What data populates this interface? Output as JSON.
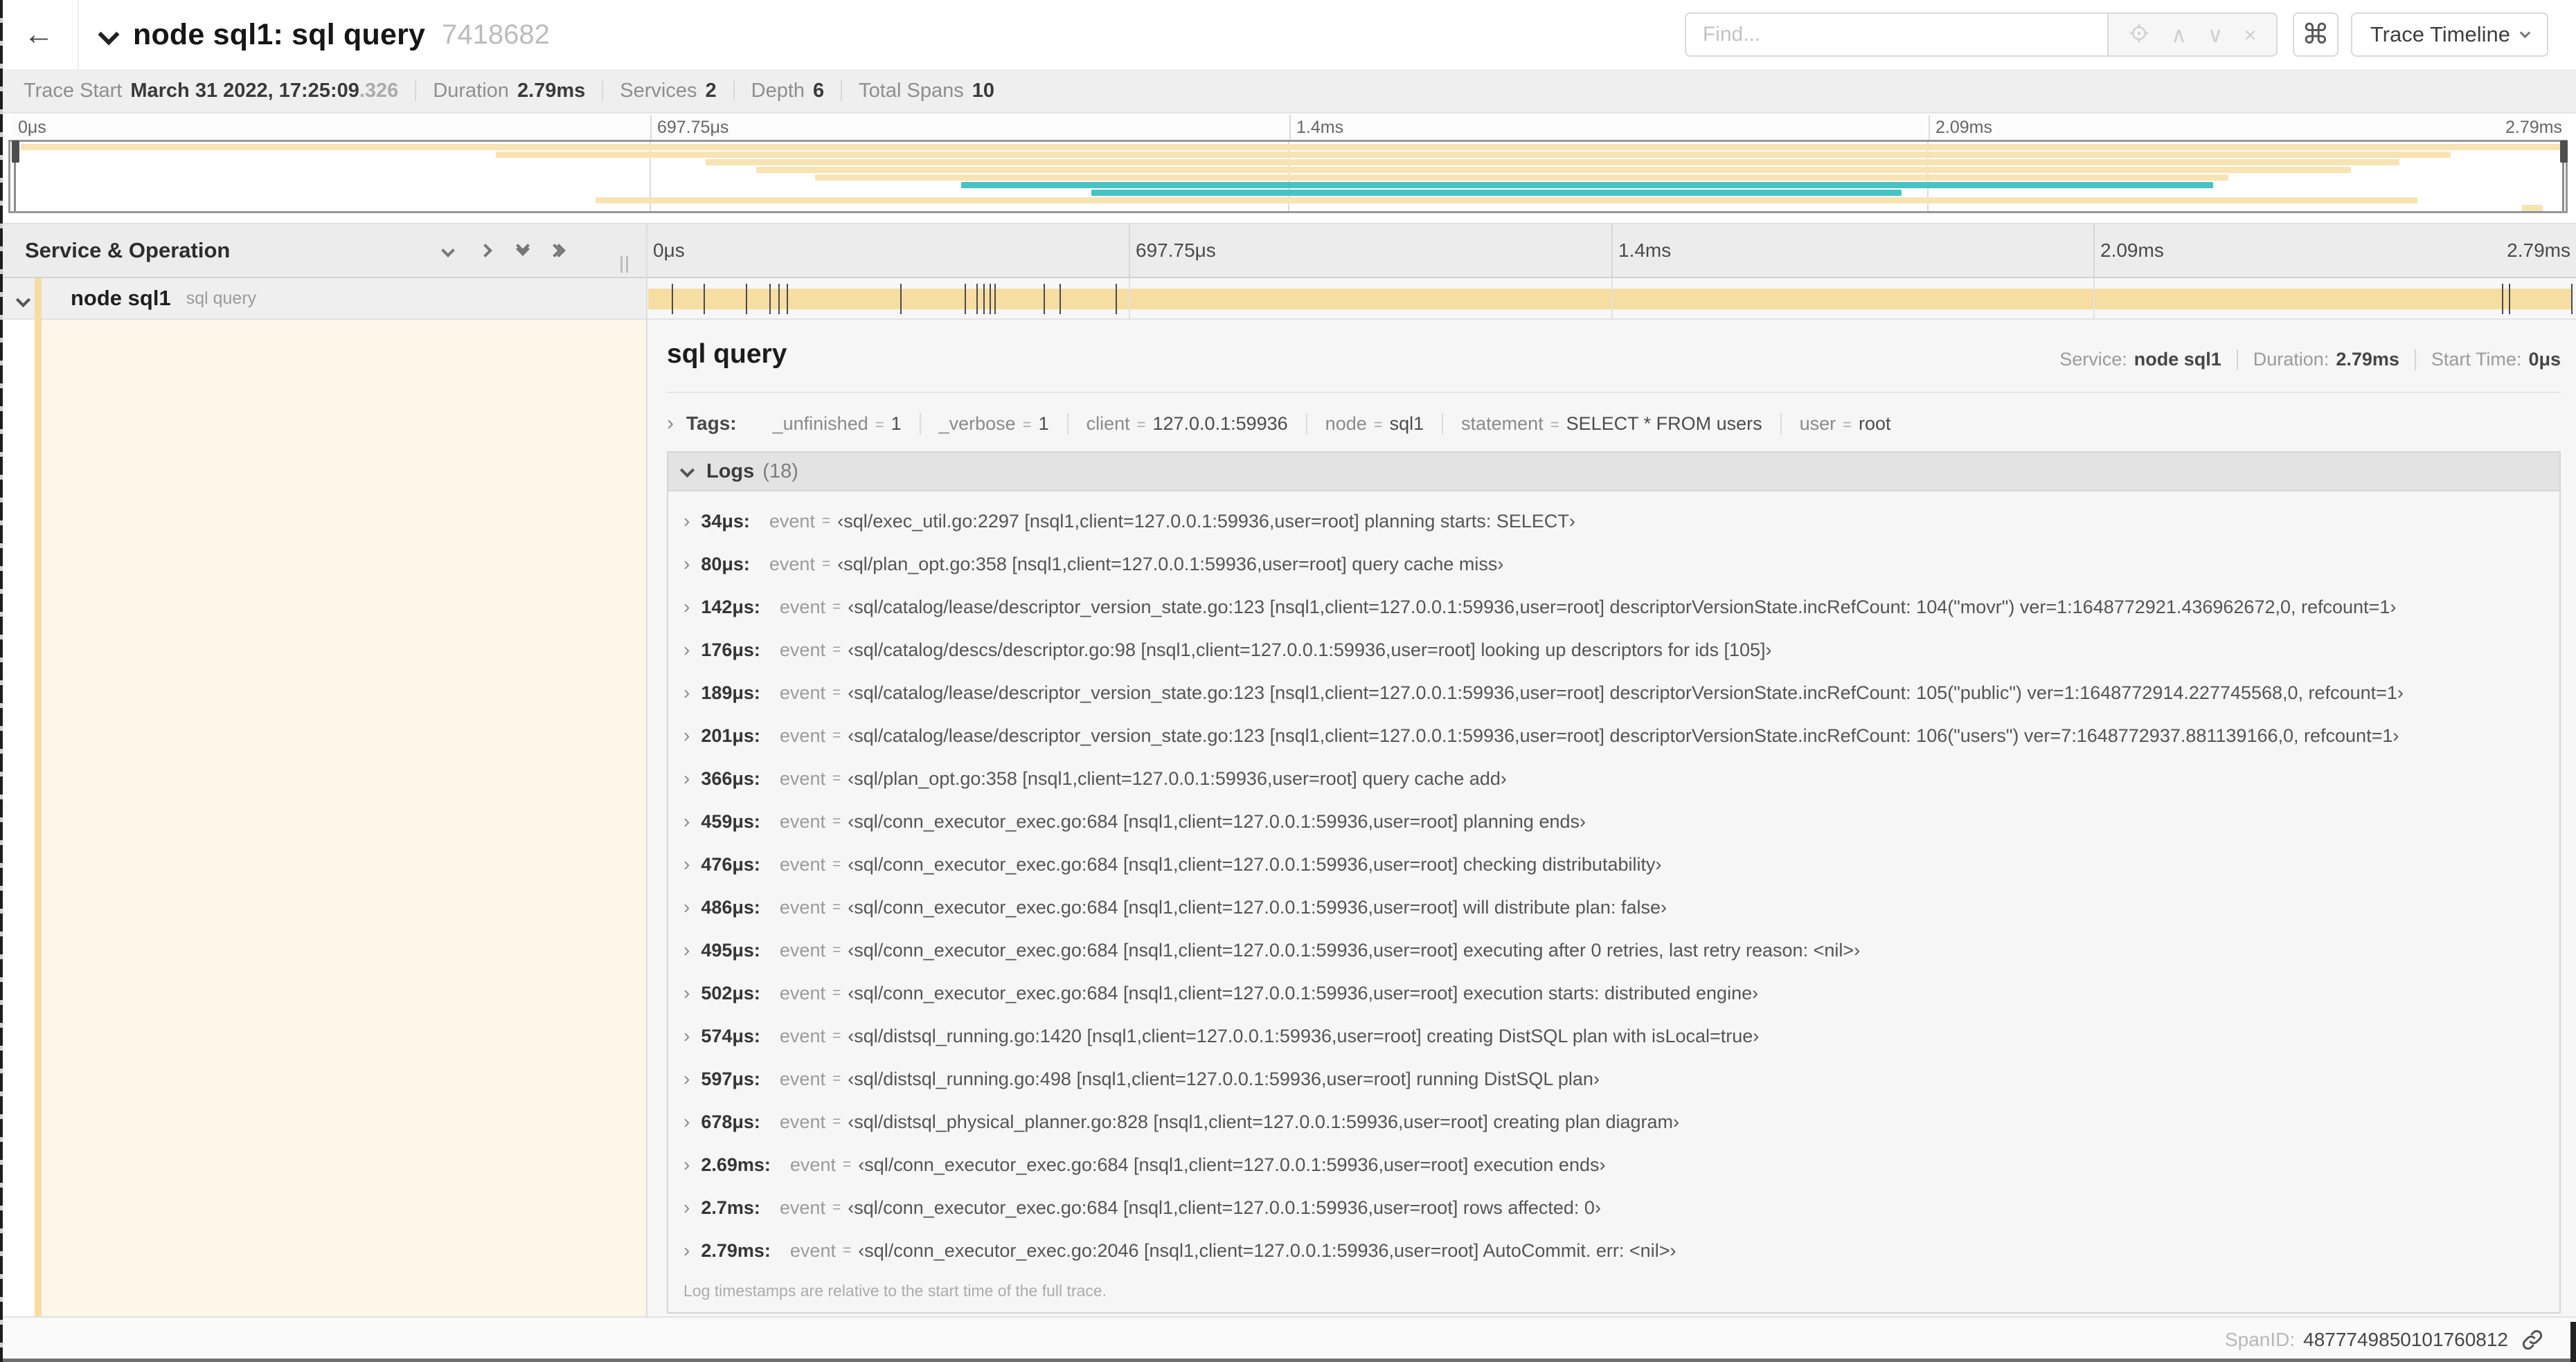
{
  "colors": {
    "tan": "#f8e3b3",
    "bar_tan": "#f6dda1",
    "teal": "#48c3c3",
    "cream": "#fdf6e9"
  },
  "header": {
    "back_icon": "←",
    "title": "node sql1: sql query",
    "trace_id": "7418682",
    "find_placeholder": "Find...",
    "icons": {
      "up": "∧",
      "down": "∨",
      "close": "×"
    },
    "shortcut_icon": "⌘",
    "view_selector": "Trace Timeline"
  },
  "summary": {
    "trace_start_label": "Trace Start",
    "trace_start_value": "March 31 2022, 17:25:09",
    "trace_start_ms": ".326",
    "duration_label": "Duration",
    "duration_value": "2.79ms",
    "services_label": "Services",
    "services_value": "2",
    "depth_label": "Depth",
    "depth_value": "6",
    "total_spans_label": "Total Spans",
    "total_spans_value": "10"
  },
  "ruler": {
    "ticks": [
      "0μs",
      "697.75μs",
      "1.4ms",
      "2.09ms",
      "2.79ms"
    ],
    "tick_positions": [
      0,
      0.25,
      0.5,
      0.75,
      1
    ]
  },
  "minimap": {
    "spans": [
      {
        "row": 0,
        "start": 0.004,
        "end": 1.0,
        "color": "tan"
      },
      {
        "row": 1,
        "start": 0.19,
        "end": 0.955,
        "color": "tan"
      },
      {
        "row": 2,
        "start": 0.272,
        "end": 0.935,
        "color": "tan"
      },
      {
        "row": 3,
        "start": 0.292,
        "end": 0.916,
        "color": "tan"
      },
      {
        "row": 4,
        "start": 0.315,
        "end": 0.868,
        "color": "tan"
      },
      {
        "row": 5,
        "start": 0.372,
        "end": 0.862,
        "color": "teal"
      },
      {
        "row": 6,
        "start": 0.423,
        "end": 0.74,
        "color": "teal"
      },
      {
        "row": 7,
        "start": 0.229,
        "end": 0.942,
        "color": "tan"
      },
      {
        "row": 8,
        "start": 0.983,
        "end": 0.991,
        "color": "tan"
      }
    ]
  },
  "timeline_header": {
    "label": "Service & Operation"
  },
  "span_row": {
    "service": "node sql1",
    "operation": "sql query",
    "trace_duration_us": 2790,
    "log_marker_times_us": [
      34,
      80,
      142,
      176,
      189,
      201,
      366,
      459,
      476,
      486,
      495,
      502,
      574,
      597,
      678,
      2690,
      2700,
      2790
    ]
  },
  "detail": {
    "title": "sql query",
    "service_label": "Service:",
    "service_value": "node sql1",
    "duration_label": "Duration:",
    "duration_value": "2.79ms",
    "start_label": "Start Time:",
    "start_value": "0μs",
    "tags": {
      "label": "Tags:",
      "chevron": "›",
      "items": [
        {
          "key": "_unfinished",
          "value": "1"
        },
        {
          "key": "_verbose",
          "value": "1"
        },
        {
          "key": "client",
          "value": "127.0.0.1:59936"
        },
        {
          "key": "node",
          "value": "sql1"
        },
        {
          "key": "statement",
          "value": "SELECT * FROM users"
        },
        {
          "key": "user",
          "value": "root"
        }
      ]
    },
    "logs": {
      "label": "Logs",
      "count": "(18)",
      "field": "event",
      "eq": "=",
      "chevron": "›",
      "entries": [
        {
          "time": "34μs:",
          "value": "‹sql/exec_util.go:2297 [nsql1,client=127.0.0.1:59936,user=root] planning starts: SELECT›"
        },
        {
          "time": "80μs:",
          "value": "‹sql/plan_opt.go:358 [nsql1,client=127.0.0.1:59936,user=root] query cache miss›"
        },
        {
          "time": "142μs:",
          "value": "‹sql/catalog/lease/descriptor_version_state.go:123 [nsql1,client=127.0.0.1:59936,user=root] descriptorVersionState.incRefCount: 104(\"movr\") ver=1:1648772921.436962672,0, refcount=1›"
        },
        {
          "time": "176μs:",
          "value": "‹sql/catalog/descs/descriptor.go:98 [nsql1,client=127.0.0.1:59936,user=root] looking up descriptors for ids [105]›"
        },
        {
          "time": "189μs:",
          "value": "‹sql/catalog/lease/descriptor_version_state.go:123 [nsql1,client=127.0.0.1:59936,user=root] descriptorVersionState.incRefCount: 105(\"public\") ver=1:1648772914.227745568,0, refcount=1›"
        },
        {
          "time": "201μs:",
          "value": "‹sql/catalog/lease/descriptor_version_state.go:123 [nsql1,client=127.0.0.1:59936,user=root] descriptorVersionState.incRefCount: 106(\"users\") ver=7:1648772937.881139166,0, refcount=1›"
        },
        {
          "time": "366μs:",
          "value": "‹sql/plan_opt.go:358 [nsql1,client=127.0.0.1:59936,user=root] query cache add›"
        },
        {
          "time": "459μs:",
          "value": "‹sql/conn_executor_exec.go:684 [nsql1,client=127.0.0.1:59936,user=root] planning ends›"
        },
        {
          "time": "476μs:",
          "value": "‹sql/conn_executor_exec.go:684 [nsql1,client=127.0.0.1:59936,user=root] checking distributability›"
        },
        {
          "time": "486μs:",
          "value": "‹sql/conn_executor_exec.go:684 [nsql1,client=127.0.0.1:59936,user=root] will distribute plan: false›"
        },
        {
          "time": "495μs:",
          "value": "‹sql/conn_executor_exec.go:684 [nsql1,client=127.0.0.1:59936,user=root] executing after 0 retries, last retry reason: <nil>›"
        },
        {
          "time": "502μs:",
          "value": "‹sql/conn_executor_exec.go:684 [nsql1,client=127.0.0.1:59936,user=root] execution starts: distributed engine›"
        },
        {
          "time": "574μs:",
          "value": "‹sql/distsql_running.go:1420 [nsql1,client=127.0.0.1:59936,user=root] creating DistSQL plan with isLocal=true›"
        },
        {
          "time": "597μs:",
          "value": "‹sql/distsql_running.go:498 [nsql1,client=127.0.0.1:59936,user=root] running DistSQL plan›"
        },
        {
          "time": "678μs:",
          "value": "‹sql/distsql_physical_planner.go:828 [nsql1,client=127.0.0.1:59936,user=root] creating plan diagram›"
        },
        {
          "time": "2.69ms:",
          "value": "‹sql/conn_executor_exec.go:684 [nsql1,client=127.0.0.1:59936,user=root] execution ends›"
        },
        {
          "time": "2.7ms:",
          "value": "‹sql/conn_executor_exec.go:684 [nsql1,client=127.0.0.1:59936,user=root] rows affected: 0›"
        },
        {
          "time": "2.79ms:",
          "value": "‹sql/conn_executor_exec.go:2046 [nsql1,client=127.0.0.1:59936,user=root] AutoCommit. err: <nil>›"
        }
      ],
      "note": "Log timestamps are relative to the start time of the full trace."
    }
  },
  "footer": {
    "spanid_label": "SpanID:",
    "spanid_value": "4877749850101760812"
  }
}
